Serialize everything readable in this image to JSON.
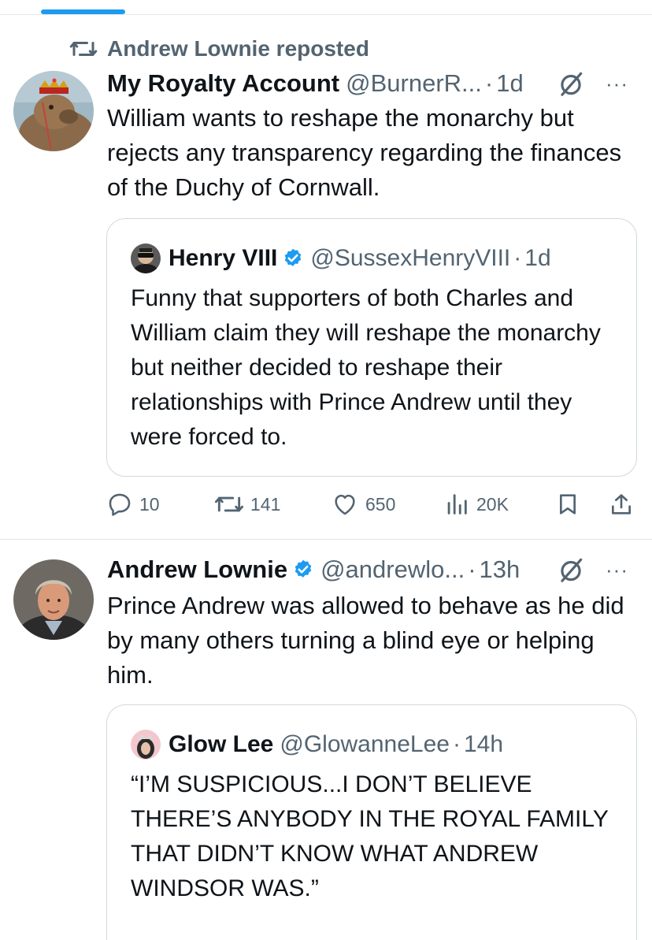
{
  "tweets": [
    {
      "repost_label": "Andrew Lownie reposted",
      "author_name": "My Royalty Account",
      "handle": "@BurnerR...",
      "dot": "·",
      "time": "1d",
      "more": "···",
      "text": "William wants to reshape the monarchy but rejects any transparency regarding the finances of the Duchy of Cornwall.",
      "quote": {
        "author_name": "Henry VIII",
        "handle": "@SussexHenryVIII",
        "dot": "·",
        "time": "1d",
        "text": "Funny that supporters of both Charles and William claim they will reshape the monarchy but neither decided to reshape their relationships with Prince Andrew until they were forced to."
      },
      "actions": {
        "replies": "10",
        "reposts": "141",
        "likes": "650",
        "views": "20K"
      }
    },
    {
      "author_name": "Andrew Lownie",
      "handle": "@andrewlo...",
      "dot": "·",
      "time": "13h",
      "more": "···",
      "text": "Prince Andrew was allowed to behave as he did by many others turning a blind eye or helping him.",
      "quote": {
        "author_name": "Glow Lee",
        "handle": "@GlowanneLee",
        "dot": "·",
        "time": "14h",
        "text": "“I’M SUSPICIOUS...I DON’T BELIEVE THERE’S ANYBODY IN THE ROYAL FAMILY THAT DIDN’T KNOW WHAT ANDREW WINDSOR WAS.”"
      }
    }
  ],
  "colors": {
    "accent": "#1d9bf0",
    "secondary_text": "#536471",
    "primary_text": "#0f1419",
    "border": "#cfd9de"
  },
  "icons": [
    "repost-icon",
    "verified-badge-icon",
    "grok-icon",
    "more-icon",
    "reply-icon",
    "like-icon",
    "views-icon",
    "bookmark-icon",
    "share-icon"
  ]
}
